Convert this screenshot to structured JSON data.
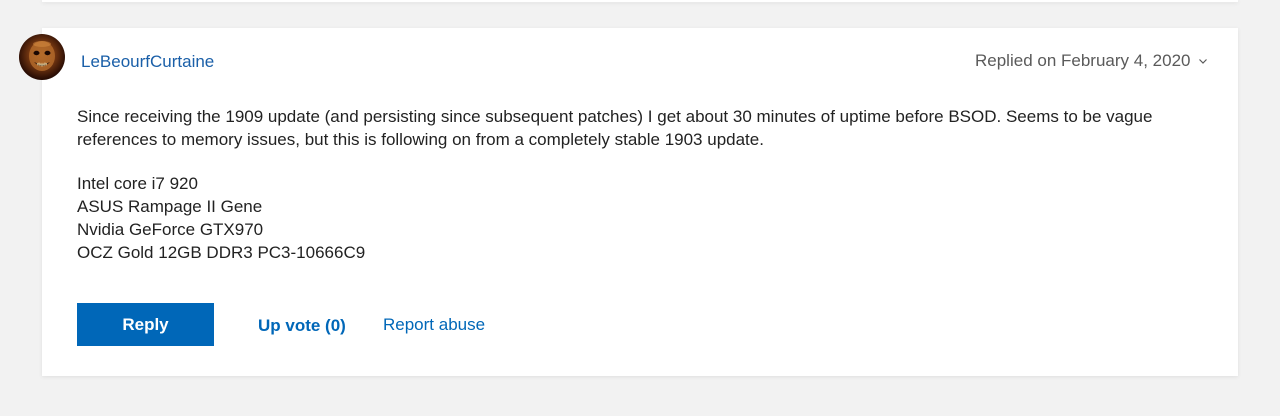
{
  "post": {
    "username": "LeBeourfCurtaine",
    "replied": "Replied on February 4, 2020",
    "paragraphs": [
      "Since receiving the 1909 update (and persisting since subsequent  patches) I get about 30 minutes of uptime before BSOD. Seems to be vague references to memory issues, but this is following on from a completely stable 1903 update."
    ],
    "specs": [
      "Intel core i7 920",
      "ASUS Rampage II Gene",
      "Nvidia GeForce GTX970",
      "OCZ Gold 12GB DDR3 PC3-10666C9"
    ]
  },
  "actions": {
    "reply_label": "Reply",
    "upvote_label": "Up vote (0)",
    "report_label": "Report abuse"
  },
  "icons": {
    "avatar": "user-avatar-image",
    "chevron": "chevron-down-icon"
  },
  "colors": {
    "link": "#1a5fa8",
    "accent": "#0067b8",
    "background": "#f2f2f2",
    "card": "#ffffff"
  }
}
